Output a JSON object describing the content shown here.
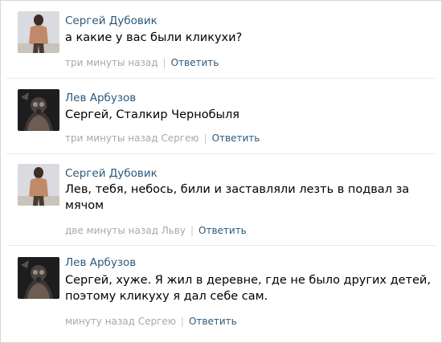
{
  "comments": [
    {
      "author": "Сергей Дубовик",
      "text": "а какие у вас были кликухи?",
      "time": "три минуты назад",
      "separator": "|",
      "reply": "Ответить",
      "avatar": "shirtless-man-avatar"
    },
    {
      "author": "Лев Арбузов",
      "text": "Сергей, Сталкир Чернобыля",
      "time": "три минуты назад Сергею",
      "separator": "|",
      "reply": "Ответить",
      "avatar": "stalker-avatar"
    },
    {
      "author": "Сергей Дубовик",
      "text": "Лев, тебя, небось, били и заставляли лезть в подвал за мячом",
      "time": "две минуты назад Льву",
      "separator": "|",
      "reply": "Ответить",
      "avatar": "shirtless-man-avatar"
    },
    {
      "author": "Лев Арбузов",
      "text": "Сергей, хуже. Я жил в деревне, где не было других детей, поэтому кликуху я дал себе сам.",
      "time": "минуту назад Сергею",
      "separator": "|",
      "reply": "Ответить",
      "avatar": "stalker-avatar"
    }
  ]
}
